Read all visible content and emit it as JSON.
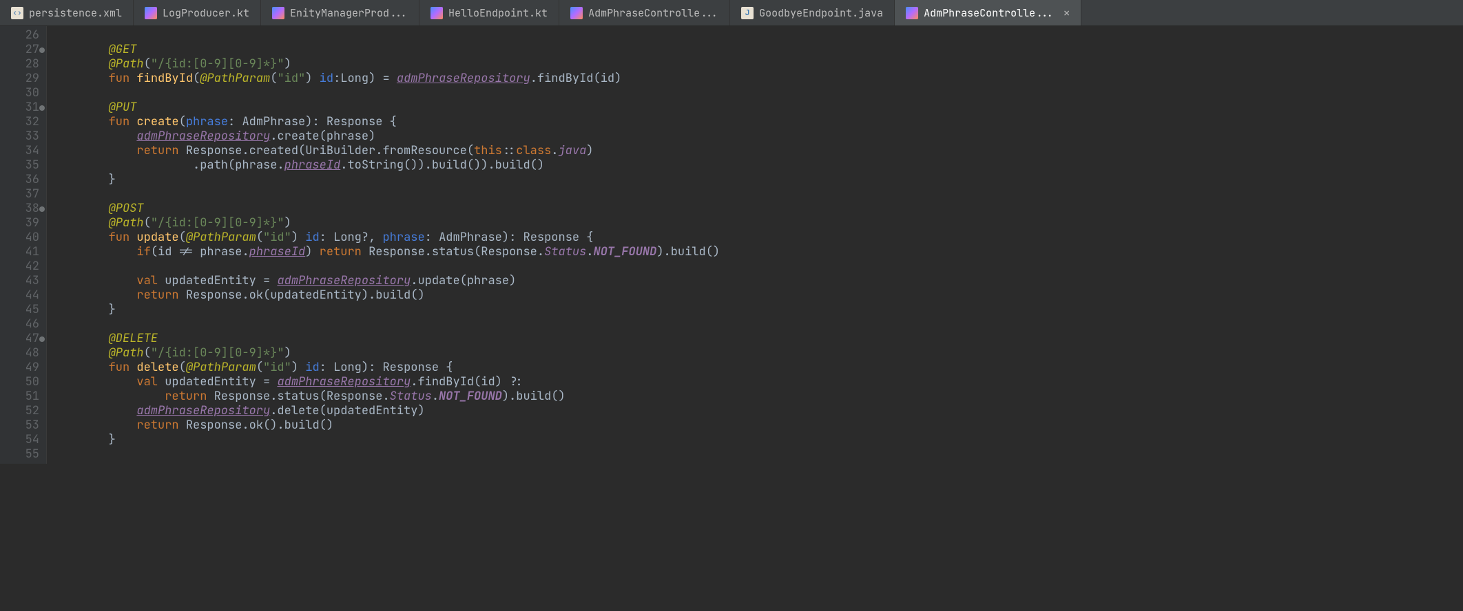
{
  "tabs": [
    {
      "label": "persistence.xml",
      "icon": "xml",
      "active": false
    },
    {
      "label": "LogProducer.kt",
      "icon": "kotlin",
      "active": false
    },
    {
      "label": "EnityManagerProd...",
      "icon": "kotlin",
      "active": false
    },
    {
      "label": "HelloEndpoint.kt",
      "icon": "kotlin",
      "active": false
    },
    {
      "label": "AdmPhraseControlle...",
      "icon": "kotlin",
      "active": false
    },
    {
      "label": "GoodbyeEndpoint.java",
      "icon": "java",
      "active": false
    },
    {
      "label": "AdmPhraseControlle...",
      "icon": "kotlin",
      "active": true,
      "closeable": true
    }
  ],
  "gutter": {
    "start": 26,
    "end": 55,
    "fold_lines": [
      27,
      31,
      38,
      47
    ]
  },
  "code_lines": {
    "26": [],
    "27": [
      [
        "ind",
        2
      ],
      [
        "ann",
        "@GET"
      ]
    ],
    "28": [
      [
        "ind",
        2
      ],
      [
        "ann",
        "@Path"
      ],
      [
        "op",
        "("
      ],
      [
        "str",
        "\"/{id:[0-9][0-9]*}\""
      ],
      [
        "op",
        ")"
      ]
    ],
    "29": [
      [
        "ind",
        2
      ],
      [
        "kw",
        "fun "
      ],
      [
        "fn",
        "findById"
      ],
      [
        "op",
        "("
      ],
      [
        "ann",
        "@PathParam"
      ],
      [
        "op",
        "("
      ],
      [
        "str",
        "\"id\""
      ],
      [
        "op",
        ") "
      ],
      [
        "param",
        "id"
      ],
      [
        "op",
        ":"
      ],
      [
        "cls",
        "Long"
      ],
      [
        "op",
        ") = "
      ],
      [
        "lnkp",
        "admPhraseRepository"
      ],
      [
        "op",
        "."
      ],
      [
        "id",
        "findById"
      ],
      [
        "op",
        "("
      ],
      [
        "id",
        "id"
      ],
      [
        "op",
        ")"
      ]
    ],
    "30": [],
    "31": [
      [
        "ind",
        2
      ],
      [
        "ann",
        "@PUT"
      ]
    ],
    "32": [
      [
        "ind",
        2
      ],
      [
        "kw",
        "fun "
      ],
      [
        "fn",
        "create"
      ],
      [
        "op",
        "("
      ],
      [
        "param",
        "phrase"
      ],
      [
        "op",
        ": "
      ],
      [
        "cls",
        "AdmPhrase"
      ],
      [
        "op",
        "): "
      ],
      [
        "cls",
        "Response"
      ],
      [
        "op",
        " {"
      ]
    ],
    "33": [
      [
        "ind",
        3
      ],
      [
        "lnkp",
        "admPhraseRepository"
      ],
      [
        "op",
        "."
      ],
      [
        "id",
        "create"
      ],
      [
        "op",
        "("
      ],
      [
        "id",
        "phrase"
      ],
      [
        "op",
        ")"
      ]
    ],
    "34": [
      [
        "ind",
        3
      ],
      [
        "kw",
        "return "
      ],
      [
        "cls",
        "Response"
      ],
      [
        "op",
        "."
      ],
      [
        "id",
        "created"
      ],
      [
        "op",
        "("
      ],
      [
        "cls",
        "UriBuilder"
      ],
      [
        "op",
        "."
      ],
      [
        "id",
        "fromResource"
      ],
      [
        "op",
        "("
      ],
      [
        "kw",
        "this"
      ],
      [
        "op",
        "::"
      ],
      [
        "kw",
        "class"
      ],
      [
        "op",
        "."
      ],
      [
        "prop",
        "java"
      ],
      [
        "op",
        ")"
      ]
    ],
    "35": [
      [
        "ind",
        5
      ],
      [
        "op",
        "."
      ],
      [
        "id",
        "path"
      ],
      [
        "op",
        "("
      ],
      [
        "id",
        "phrase"
      ],
      [
        "op",
        "."
      ],
      [
        "lnkp",
        "phraseId"
      ],
      [
        "op",
        "."
      ],
      [
        "id",
        "toString"
      ],
      [
        "op",
        "())."
      ],
      [
        "id",
        "build"
      ],
      [
        "op",
        "())."
      ],
      [
        "id",
        "build"
      ],
      [
        "op",
        "()"
      ]
    ],
    "36": [
      [
        "ind",
        2
      ],
      [
        "op",
        "}"
      ]
    ],
    "37": [],
    "38": [
      [
        "ind",
        2
      ],
      [
        "ann",
        "@POST"
      ]
    ],
    "39": [
      [
        "ind",
        2
      ],
      [
        "ann",
        "@Path"
      ],
      [
        "op",
        "("
      ],
      [
        "str",
        "\"/{id:[0-9][0-9]*}\""
      ],
      [
        "op",
        ")"
      ]
    ],
    "40": [
      [
        "ind",
        2
      ],
      [
        "kw",
        "fun "
      ],
      [
        "fn",
        "update"
      ],
      [
        "op",
        "("
      ],
      [
        "ann",
        "@PathParam"
      ],
      [
        "op",
        "("
      ],
      [
        "str",
        "\"id\""
      ],
      [
        "op",
        ") "
      ],
      [
        "param",
        "id"
      ],
      [
        "op",
        ": "
      ],
      [
        "cls",
        "Long?"
      ],
      [
        "op",
        ", "
      ],
      [
        "param",
        "phrase"
      ],
      [
        "op",
        ": "
      ],
      [
        "cls",
        "AdmPhrase"
      ],
      [
        "op",
        "): "
      ],
      [
        "cls",
        "Response"
      ],
      [
        "op",
        " {"
      ]
    ],
    "41": [
      [
        "ind",
        3
      ],
      [
        "kw",
        "if"
      ],
      [
        "op",
        "("
      ],
      [
        "id",
        "id"
      ],
      [
        "op",
        " != "
      ],
      [
        "id",
        "phrase"
      ],
      [
        "op",
        "."
      ],
      [
        "lnkp",
        "phraseId"
      ],
      [
        "op",
        ") "
      ],
      [
        "kw",
        "return "
      ],
      [
        "cls",
        "Response"
      ],
      [
        "op",
        "."
      ],
      [
        "id",
        "status"
      ],
      [
        "op",
        "("
      ],
      [
        "cls",
        "Response"
      ],
      [
        "op",
        "."
      ],
      [
        "prop",
        "Status"
      ],
      [
        "op",
        "."
      ],
      [
        "enum",
        "NOT_FOUND"
      ],
      [
        "op",
        ")."
      ],
      [
        "id",
        "build"
      ],
      [
        "op",
        "()"
      ]
    ],
    "42": [],
    "43": [
      [
        "ind",
        3
      ],
      [
        "kw",
        "val "
      ],
      [
        "lvar",
        "updatedEntity"
      ],
      [
        "op",
        " = "
      ],
      [
        "lnkp",
        "admPhraseRepository"
      ],
      [
        "op",
        "."
      ],
      [
        "id",
        "update"
      ],
      [
        "op",
        "("
      ],
      [
        "id",
        "phrase"
      ],
      [
        "op",
        ")"
      ]
    ],
    "44": [
      [
        "ind",
        3
      ],
      [
        "kw",
        "return "
      ],
      [
        "cls",
        "Response"
      ],
      [
        "op",
        "."
      ],
      [
        "id",
        "ok"
      ],
      [
        "op",
        "("
      ],
      [
        "id",
        "updatedEntity"
      ],
      [
        "op",
        ")."
      ],
      [
        "id",
        "build"
      ],
      [
        "op",
        "()"
      ]
    ],
    "45": [
      [
        "ind",
        2
      ],
      [
        "op",
        "}"
      ]
    ],
    "46": [],
    "47": [
      [
        "ind",
        2
      ],
      [
        "ann",
        "@DELETE"
      ]
    ],
    "48": [
      [
        "ind",
        2
      ],
      [
        "ann",
        "@Path"
      ],
      [
        "op",
        "("
      ],
      [
        "str",
        "\"/{id:[0-9][0-9]*}\""
      ],
      [
        "op",
        ")"
      ]
    ],
    "49": [
      [
        "ind",
        2
      ],
      [
        "kw",
        "fun "
      ],
      [
        "fn",
        "delete"
      ],
      [
        "op",
        "("
      ],
      [
        "ann",
        "@PathParam"
      ],
      [
        "op",
        "("
      ],
      [
        "str",
        "\"id\""
      ],
      [
        "op",
        ") "
      ],
      [
        "param",
        "id"
      ],
      [
        "op",
        ": "
      ],
      [
        "cls",
        "Long"
      ],
      [
        "op",
        "): "
      ],
      [
        "cls",
        "Response"
      ],
      [
        "op",
        " {"
      ]
    ],
    "50": [
      [
        "ind",
        3
      ],
      [
        "kw",
        "val "
      ],
      [
        "lvar",
        "updatedEntity"
      ],
      [
        "op",
        " = "
      ],
      [
        "lnkp",
        "admPhraseRepository"
      ],
      [
        "op",
        "."
      ],
      [
        "id",
        "findById"
      ],
      [
        "op",
        "("
      ],
      [
        "id",
        "id"
      ],
      [
        "op",
        ") ?:"
      ]
    ],
    "51": [
      [
        "ind",
        4
      ],
      [
        "kw",
        "return "
      ],
      [
        "cls",
        "Response"
      ],
      [
        "op",
        "."
      ],
      [
        "id",
        "status"
      ],
      [
        "op",
        "("
      ],
      [
        "cls",
        "Response"
      ],
      [
        "op",
        "."
      ],
      [
        "prop",
        "Status"
      ],
      [
        "op",
        "."
      ],
      [
        "enum",
        "NOT_FOUND"
      ],
      [
        "op",
        ")."
      ],
      [
        "id",
        "build"
      ],
      [
        "op",
        "()"
      ]
    ],
    "52": [
      [
        "ind",
        3
      ],
      [
        "lnkp",
        "admPhraseRepository"
      ],
      [
        "op",
        "."
      ],
      [
        "id",
        "delete"
      ],
      [
        "op",
        "("
      ],
      [
        "id",
        "updatedEntity"
      ],
      [
        "op",
        ")"
      ]
    ],
    "53": [
      [
        "ind",
        3
      ],
      [
        "kw",
        "return "
      ],
      [
        "cls",
        "Response"
      ],
      [
        "op",
        "."
      ],
      [
        "id",
        "ok"
      ],
      [
        "op",
        "()."
      ],
      [
        "id",
        "build"
      ],
      [
        "op",
        "()"
      ]
    ],
    "54": [
      [
        "ind",
        2
      ],
      [
        "op",
        "}"
      ]
    ],
    "55": []
  }
}
